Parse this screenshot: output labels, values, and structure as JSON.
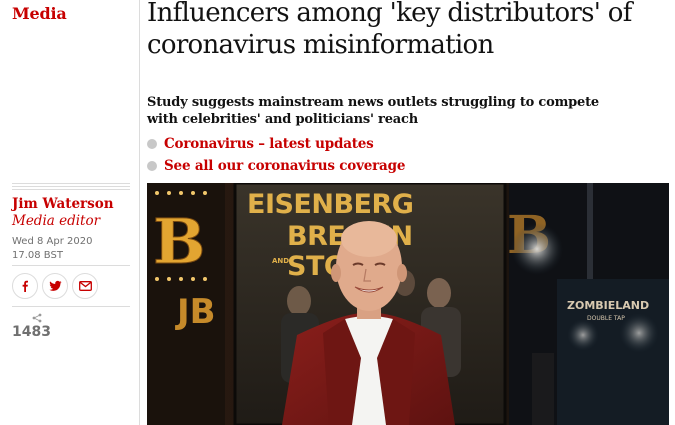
{
  "section": {
    "label": "Media"
  },
  "article": {
    "headline": "Influencers among 'key distributors' of coronavirus misinformation",
    "standfirst": "Study suggests mainstream news outlets struggling to compete with celebrities' and politicians' reach",
    "links": [
      {
        "label": "Coronavirus – latest updates"
      },
      {
        "label": "See all our coronavirus coverage"
      }
    ]
  },
  "byline": {
    "name": "Jim Waterson",
    "role": "Media editor",
    "date": "Wed 8 Apr 2020",
    "time": "17.08 BST"
  },
  "share": {
    "buttons": [
      {
        "icon": "facebook-icon"
      },
      {
        "icon": "twitter-icon"
      },
      {
        "icon": "email-icon"
      }
    ],
    "count": "1483"
  },
  "photo": {
    "poster_text": [
      "EISENBERG",
      "BRESLIN",
      "AND",
      "STONE"
    ],
    "letters_left": "B",
    "letters_left2": "JB",
    "right_sign": "ZOMBIELAND",
    "right_sign_sub": "DOUBLE TAP"
  },
  "colors": {
    "accent": "#c70000",
    "text": "#121212",
    "muted": "#707070",
    "divider": "#dcdcdc"
  }
}
